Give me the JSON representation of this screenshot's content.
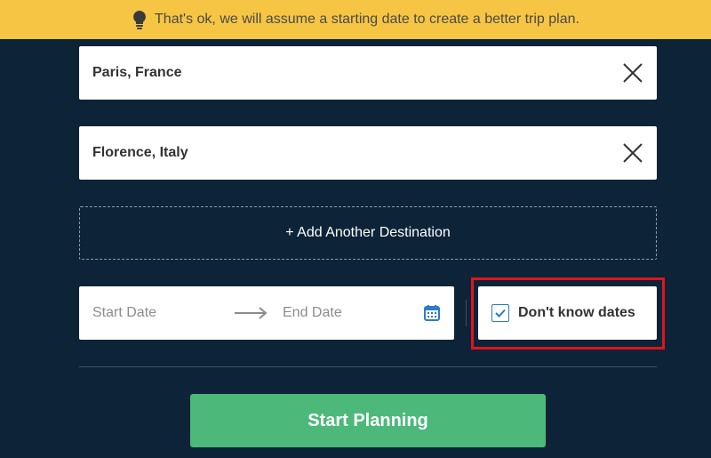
{
  "banner": {
    "icon": "lightbulb-icon",
    "text": "That's ok, we will assume a starting date to create a better trip plan."
  },
  "destinations": [
    {
      "name": "Paris, France",
      "clear_icon": "close-icon"
    },
    {
      "name": "Florence, Italy",
      "clear_icon": "close-icon"
    }
  ],
  "add_destination_label": "+ Add Another Destination",
  "dates": {
    "start_placeholder": "Start Date",
    "end_placeholder": "End Date",
    "arrow_icon": "arrow-right-icon",
    "calendar_icon": "calendar-icon"
  },
  "dont_know_dates": {
    "label": "Don't know dates",
    "checked": true
  },
  "start_button_label": "Start Planning",
  "colors": {
    "background": "#0d2438",
    "banner": "#f6c543",
    "accent_green": "#4cb97a",
    "highlight_red": "#e0141c",
    "checkbox_blue": "#2c7cc7"
  }
}
